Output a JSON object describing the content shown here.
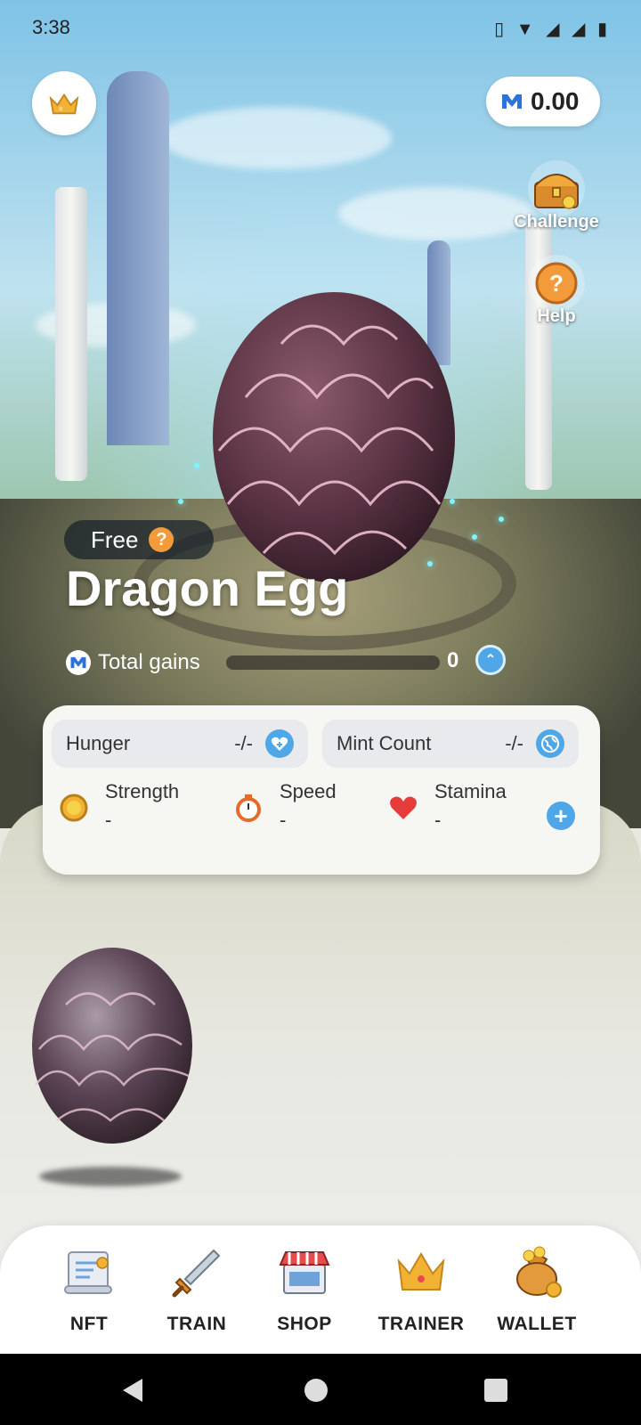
{
  "status_bar": {
    "time": "3:38"
  },
  "balance": {
    "value": "0.00"
  },
  "side_actions": {
    "challenge_label": "Challenge",
    "help_label": "Help"
  },
  "pet": {
    "tag": "Free",
    "name": "Dragon Egg",
    "gains_label": "Total gains",
    "gains_value": "0"
  },
  "stats": {
    "hunger_label": "Hunger",
    "hunger_value": "-/-",
    "mint_label": "Mint Count",
    "mint_value": "-/-",
    "strength_label": "Strength",
    "strength_value": "-",
    "speed_label": "Speed",
    "speed_value": "-",
    "stamina_label": "Stamina",
    "stamina_value": "-"
  },
  "nav": {
    "items": [
      {
        "label": "NFT",
        "icon": "scroll-icon"
      },
      {
        "label": "TRAIN",
        "icon": "sword-icon"
      },
      {
        "label": "SHOP",
        "icon": "shop-icon"
      },
      {
        "label": "TRAINER",
        "icon": "crown-icon"
      },
      {
        "label": "WALLET",
        "icon": "money-bag-icon"
      }
    ]
  },
  "colors": {
    "accent": "#4fa7e8",
    "gold": "#f2b233",
    "free_tag_q": "#f39b3a"
  }
}
